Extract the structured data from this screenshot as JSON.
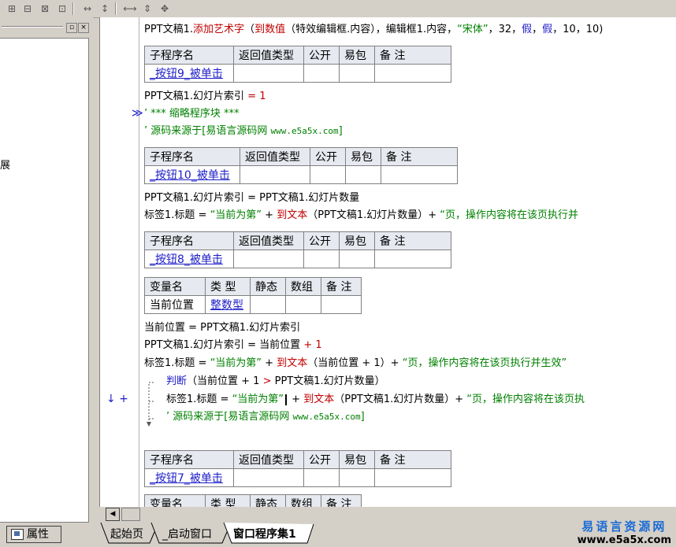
{
  "toolbar": {
    "icons": [
      "align-left-icon",
      "align-center-icon",
      "align-right-icon",
      "distribute-icon",
      "width-icon",
      "height-icon",
      "same-width-icon",
      "same-height-icon",
      "center-icon"
    ]
  },
  "left_panel": {
    "glyph": "展",
    "close_box": "×",
    "min_box": "▫"
  },
  "properties_tab": {
    "label": "属性"
  },
  "code": {
    "line1": {
      "obj": "PPT文稿1.",
      "call": "添加艺术字",
      "lp": "（",
      "fn": "到数值",
      "rest": "（特效编辑框.内容），编辑框1.内容，",
      "str": "“宋体”",
      "tail": "，32，",
      "b1": "假",
      "c1": "，",
      "b2": "假",
      "tail2": "，10，10)"
    },
    "sub9": {
      "h": [
        "子程序名",
        "返回值类型",
        "公开",
        "易包",
        "备 注"
      ],
      "name": "_按钮9_被单击"
    },
    "line_idx1": {
      "a": "PPT文稿1.幻灯片索引 ",
      "eq": "=",
      "val": " 1"
    },
    "folded": "’ *** 缩略程序块 ***",
    "source1": {
      "a": "’ 源码来源于[易语言源码网 ",
      "url": "www.e5a5x.com",
      "b": "]"
    },
    "sub10": {
      "h": [
        "子程序名",
        "返回值类型",
        "公开",
        "易包",
        "备 注"
      ],
      "name": "_按钮10_被单击"
    },
    "line_idx2": "PPT文稿1.幻灯片索引 = PPT文稿1.幻灯片数量",
    "line_lbl1": {
      "a": "标签1.标题 = ",
      "s1": "“当前为第”",
      "b": " + ",
      "fn": "到文本",
      "c": "（PPT文稿1.幻灯片数量）+ ",
      "s2": "“页，操作内容将在该页执行并"
    },
    "sub8": {
      "h": [
        "子程序名",
        "返回值类型",
        "公开",
        "易包",
        "备 注"
      ],
      "name": "_按钮8_被单击"
    },
    "vars": {
      "h": [
        "变量名",
        "类 型",
        "静态",
        "数组",
        "备 注"
      ],
      "name": "当前位置",
      "type": "整数型"
    },
    "line_pos1": "当前位置 = PPT文稿1.幻灯片索引",
    "line_idx3": {
      "a": "PPT文稿1.幻灯片索引 = 当前位置 ",
      "op": "+",
      "val": " 1"
    },
    "line_lbl2": {
      "a": "标签1.标题 = ",
      "s1": "“当前为第”",
      "b": " + ",
      "fn": "到文本",
      "c": "（当前位置 + 1）+ ",
      "s2": "“页，操作内容将在该页执行并生效”"
    },
    "line_if": {
      "kw": "判断",
      "a": "（当前位置 + 1 ",
      "op": ">",
      "b": " PPT文稿1.幻灯片数量）"
    },
    "line_lbl3": {
      "a": "标签1.标题 = ",
      "s1": "“当前为第”",
      "b": " + ",
      "fn": "到文本",
      "c": "（PPT文稿1.幻灯片数量）+ ",
      "s2": "“页，操作内容将在该页执"
    },
    "source2": {
      "a": "’ 源码来源于[易语言源码网 ",
      "url": "www.e5a5x.com",
      "b": "]"
    },
    "sub7": {
      "h": [
        "子程序名",
        "返回值类型",
        "公开",
        "易包",
        "备 注"
      ],
      "name": "_按钮7_被单击"
    },
    "vars2": {
      "h": [
        "变量名",
        "类 型",
        "静态",
        "数组",
        "备 注"
      ]
    }
  },
  "tabs": [
    "起始页",
    "_启动窗口",
    "窗口程序集1"
  ],
  "watermark": {
    "line1": "易语言资源网",
    "line2": "www.e5a5x.com"
  }
}
